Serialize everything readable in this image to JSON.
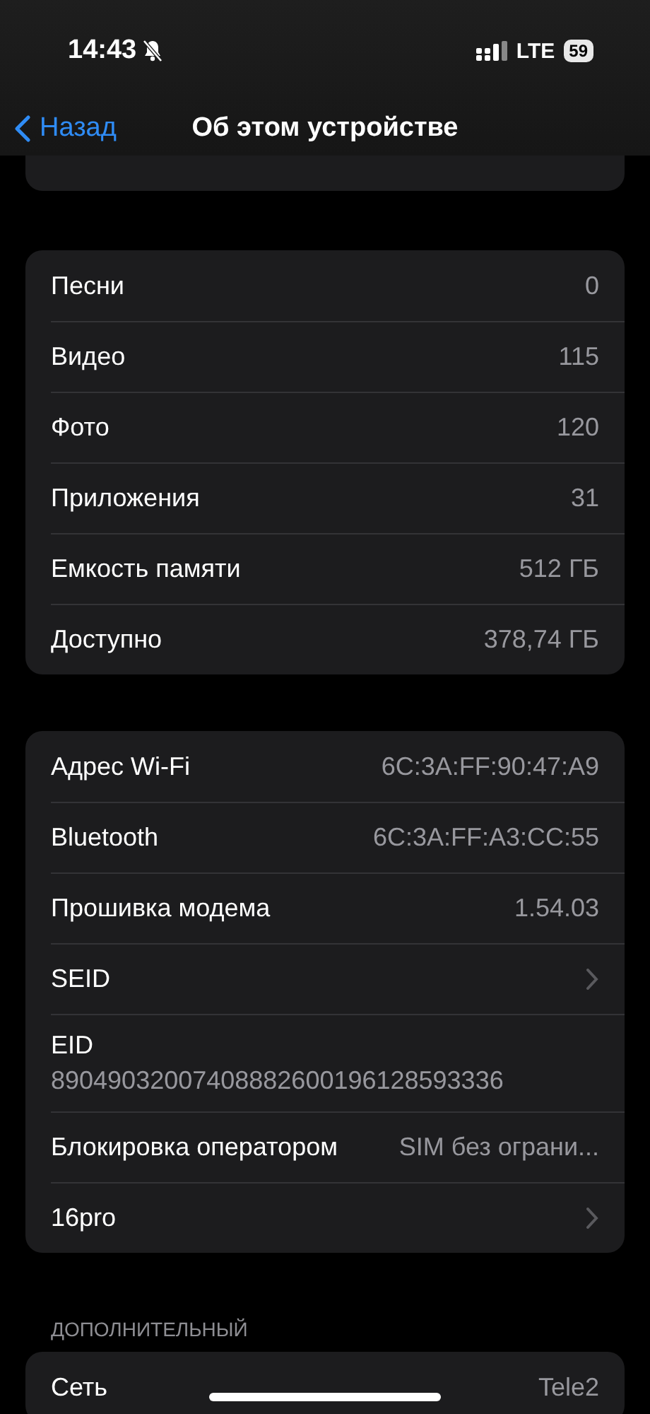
{
  "status_bar": {
    "time": "14:43",
    "network": "LTE",
    "battery": "59",
    "silent": true
  },
  "nav": {
    "back": "Назад",
    "title": "Об этом устройстве"
  },
  "clipped_row": {
    "kind": "card_edge"
  },
  "groups": [
    {
      "rows": [
        {
          "kind": "value",
          "label": "Песни",
          "value": "0"
        },
        {
          "kind": "value",
          "label": "Видео",
          "value": "115"
        },
        {
          "kind": "value",
          "label": "Фото",
          "value": "120"
        },
        {
          "kind": "value",
          "label": "Приложения",
          "value": "31"
        },
        {
          "kind": "value",
          "label": "Емкость памяти",
          "value": "512 ГБ"
        },
        {
          "kind": "value",
          "label": "Доступно",
          "value": "378,74 ГБ"
        }
      ]
    },
    {
      "rows": [
        {
          "kind": "value",
          "label": "Адрес Wi-Fi",
          "value": "6C:3A:FF:90:47:A9"
        },
        {
          "kind": "value",
          "label": "Bluetooth",
          "value": "6C:3A:FF:A3:CC:55"
        },
        {
          "kind": "value",
          "label": "Прошивка модема",
          "value": "1.54.03"
        },
        {
          "kind": "chevron",
          "label": "SEID"
        },
        {
          "kind": "stacked",
          "label": "EID",
          "value": "89049032007408882600196128593336"
        },
        {
          "kind": "value",
          "label": "Блокировка оператором",
          "value": "SIM без ограни..."
        },
        {
          "kind": "chevron",
          "label": "16pro"
        }
      ]
    },
    {
      "header": "ДОПОЛНИТЕЛЬНЫЙ",
      "rows": [
        {
          "kind": "value",
          "label": "Сеть",
          "value": "Tele2"
        }
      ]
    }
  ]
}
